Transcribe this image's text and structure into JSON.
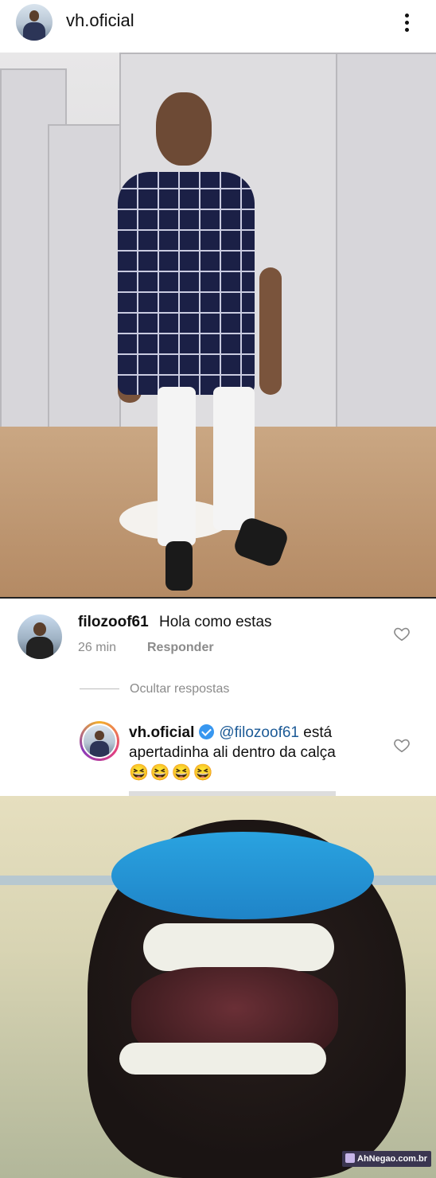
{
  "post": {
    "username": "vh.oficial"
  },
  "comment": {
    "username": "filozoof61",
    "text": "Hola como estas",
    "time": "26 min",
    "reply_label": "Responder"
  },
  "hide_replies_label": "Ocultar respostas",
  "reply": {
    "username": "vh.oficial",
    "mention": "@filozoof61",
    "text_part1": "está",
    "text_line2": "apertadinha ali dentro da calça",
    "emojis": "😆😆😆😆"
  },
  "watermark": {
    "text": "AhNegao.com.br"
  },
  "colors": {
    "mention": "#1c5a96",
    "verified": "#3897f0",
    "meta": "#8b8b8b"
  }
}
